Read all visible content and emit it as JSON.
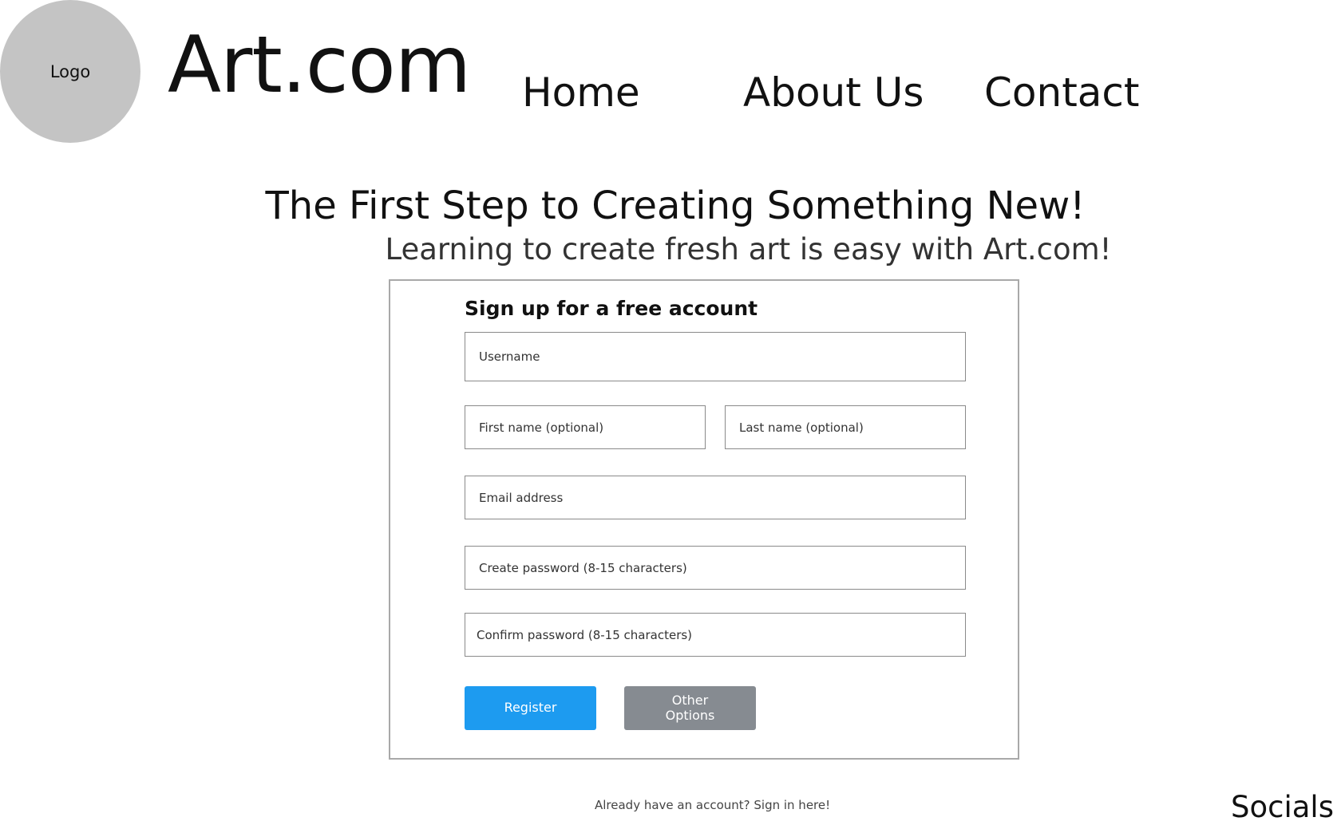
{
  "header": {
    "logo_label": "Logo",
    "site_name": "Art.com",
    "nav": {
      "home": "Home",
      "about": "About Us",
      "contact": "Contact"
    }
  },
  "hero": {
    "headline": "The First Step to Creating Something New!",
    "subheadline": "Learning to create fresh art is easy with Art.com!"
  },
  "signup_form": {
    "title": "Sign up for a free account",
    "fields": {
      "username": {
        "placeholder": "Username",
        "value": ""
      },
      "first_name": {
        "placeholder": "First name (optional)",
        "value": ""
      },
      "last_name": {
        "placeholder": "Last name (optional)",
        "value": ""
      },
      "email": {
        "placeholder": "Email address",
        "value": ""
      },
      "password": {
        "placeholder": "Create password (8-15 characters)",
        "value": ""
      },
      "confirm_password": {
        "placeholder": "Confirm password (8-15 characters)",
        "value": ""
      }
    },
    "register_label": "Register",
    "other_options_label": "Other Options",
    "colors": {
      "register": "#1d9bf0",
      "other_options": "#868b91"
    }
  },
  "footer": {
    "signin_text": "Already have an account? Sign in here!",
    "socials_label": "Socials"
  }
}
